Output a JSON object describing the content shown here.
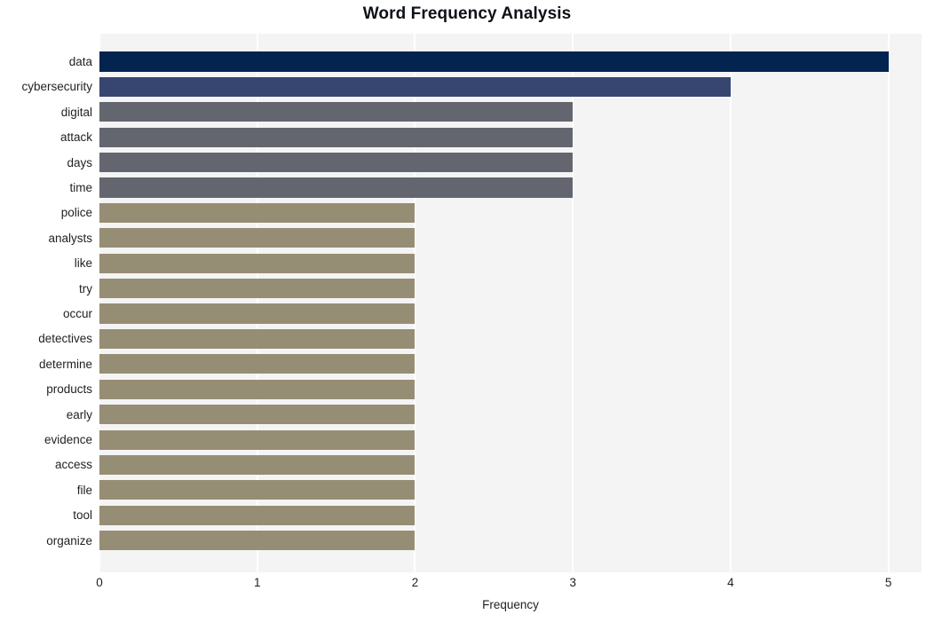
{
  "chart_data": {
    "type": "bar",
    "orientation": "horizontal",
    "title": "Word Frequency Analysis",
    "xlabel": "Frequency",
    "ylabel": "",
    "categories": [
      "data",
      "cybersecurity",
      "digital",
      "attack",
      "days",
      "time",
      "police",
      "analysts",
      "like",
      "try",
      "occur",
      "detectives",
      "determine",
      "products",
      "early",
      "evidence",
      "access",
      "file",
      "tool",
      "organize"
    ],
    "values": [
      5,
      4,
      3,
      3,
      3,
      3,
      2,
      2,
      2,
      2,
      2,
      2,
      2,
      2,
      2,
      2,
      2,
      2,
      2,
      2
    ],
    "bar_colors": [
      "#042450",
      "#374670",
      "#63666e",
      "#63666e",
      "#63666e",
      "#63666e",
      "#968d75",
      "#968d75",
      "#968d75",
      "#968d75",
      "#968d75",
      "#968d75",
      "#968d75",
      "#968d75",
      "#968d75",
      "#968d75",
      "#968d75",
      "#968d75",
      "#968d75",
      "#968d75"
    ],
    "xlim": [
      0,
      5.21
    ],
    "xticks": [
      0,
      1,
      2,
      3,
      4,
      5
    ],
    "xtick_labels": [
      "0",
      "1",
      "2",
      "3",
      "4",
      "5"
    ],
    "grid": true,
    "grid_axis": "x",
    "grid_color": "#ffffff",
    "legend": false,
    "plot_background": "#f4f4f5",
    "figure_background": "#ffffff"
  }
}
